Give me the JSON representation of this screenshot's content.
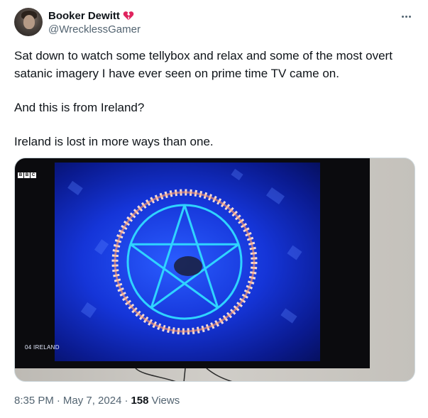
{
  "author": {
    "display_name": "Booker Dewitt",
    "handle": "@WrecklessGamer",
    "badge_icon": "broken-heart-icon"
  },
  "tweet": {
    "paragraphs": [
      "Sat down to watch some tellybox and relax and some of the most overt satanic imagery I have ever seen on prime time TV came on.",
      "And this is from Ireland?",
      "Ireland is lost in more ways than one."
    ]
  },
  "media": {
    "channel_logo": [
      "B",
      "B",
      "C"
    ],
    "caption": "04 IRELAND"
  },
  "meta": {
    "time": "8:35 PM",
    "separator": "·",
    "date": "May 7, 2024",
    "views_count": "158",
    "views_label": "Views"
  },
  "colors": {
    "text_primary": "#0f1419",
    "text_secondary": "#536471",
    "screen_blue": "#1535d8",
    "ring_glow": "#ffd9c7",
    "pentagram_cyan": "#2fd4ff"
  }
}
